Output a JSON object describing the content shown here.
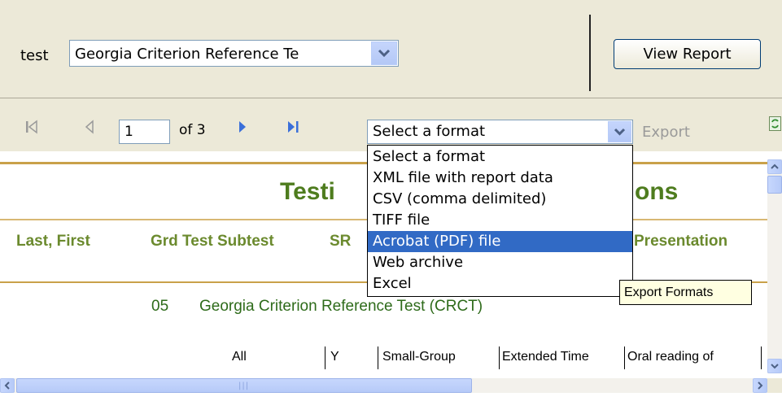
{
  "parameters": {
    "label": "test",
    "test_select_value": "Georgia Criterion Reference Te",
    "view_report_label": "View Report"
  },
  "toolbar": {
    "page_number": "1",
    "page_of": "of 3",
    "format_select_value": "Select a format",
    "export_label": "Export"
  },
  "format_dropdown": {
    "options": [
      "Select a format",
      "XML file with report data",
      "CSV (comma delimited)",
      "TIFF file",
      "Acrobat (PDF) file",
      "Web archive",
      "Excel"
    ],
    "highlighted_index": 4
  },
  "tooltip": "Export Formats",
  "report": {
    "title_visible": "Testi",
    "title_tail_visible": "ons",
    "columns": {
      "name": "Last, First",
      "grd_test_subtest": "Grd Test Subtest",
      "src": "SR",
      "presentation": "Presentation"
    },
    "row": {
      "grade": "05",
      "test_name": "Georgia Criterion Reference Test (CRCT)"
    },
    "accommodations": [
      "All",
      "Y",
      "Small-Group",
      "Extended Time",
      "Oral reading of"
    ]
  },
  "colors": {
    "chrome": "#ece9d8",
    "report_title": "#4e7c1e",
    "rule": "#c9a14a",
    "selection": "#316ac5",
    "tooltip_bg": "#ffffe1"
  }
}
